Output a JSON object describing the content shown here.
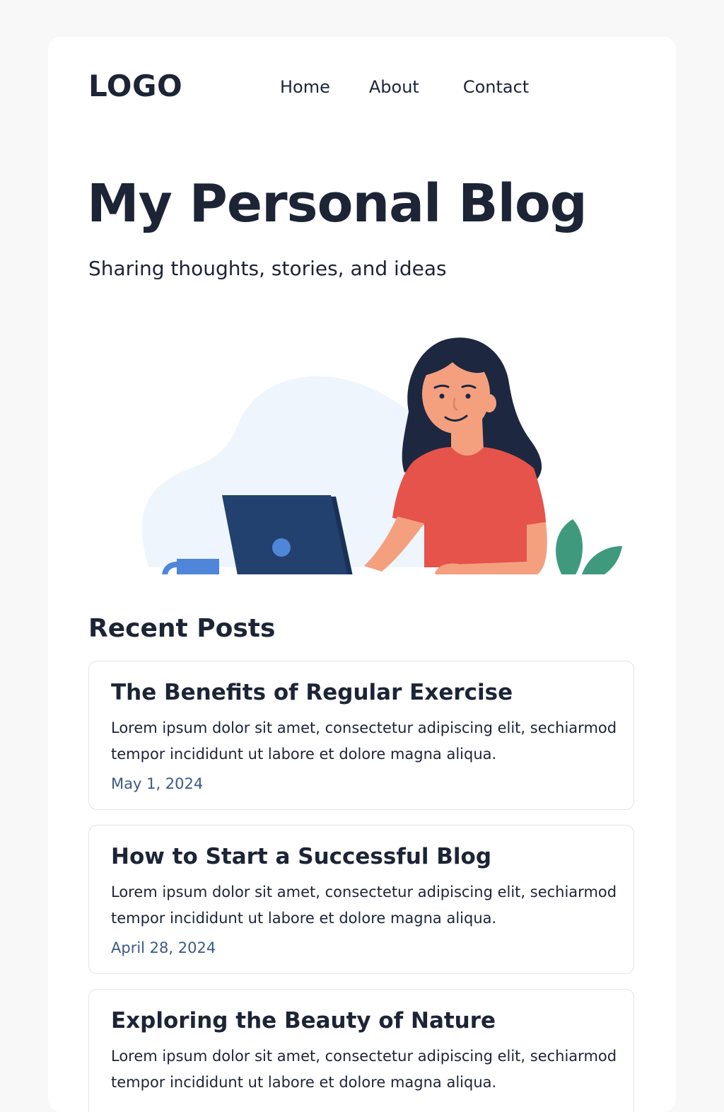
{
  "header": {
    "logo": "LOGO",
    "nav": [
      {
        "label": "Home"
      },
      {
        "label": "About"
      },
      {
        "label": "Contact"
      }
    ]
  },
  "hero": {
    "title": "My Personal Blog",
    "subtitle": "Sharing thoughts, stories, and ideas",
    "illustration": "woman-working-on-laptop-illustration"
  },
  "recent": {
    "title": "Recent Posts",
    "posts": [
      {
        "title": "The Benefits of Regular Exercise",
        "excerpt": "Lorem ipsum dolor sit amet, consectetur adipiscing elit, sechiarmod tempor incididunt ut labore et dolore magna aliqua.",
        "date": "May 1, 2024"
      },
      {
        "title": "How to Start a Successful Blog",
        "excerpt": "Lorem ipsum dolor sit amet, consectetur adipiscing elit, sechiarmod tempor incididunt ut labore et dolore magna aliqua.",
        "date": "April 28, 2024"
      },
      {
        "title": "Exploring the Beauty of Nature",
        "excerpt": "Lorem ipsum dolor sit amet, consectetur adipiscing elit, sechiarmod tempor incididunt ut labore et dolore magna aliqua.",
        "date": ""
      }
    ]
  },
  "colors": {
    "text": "#1c2436",
    "date": "#3b5a82",
    "card_border": "#e2e4e8",
    "shirt": "#e5534b",
    "laptop": "#22416e",
    "mug": "#4f86d9",
    "plant": "#3f9a7d"
  }
}
